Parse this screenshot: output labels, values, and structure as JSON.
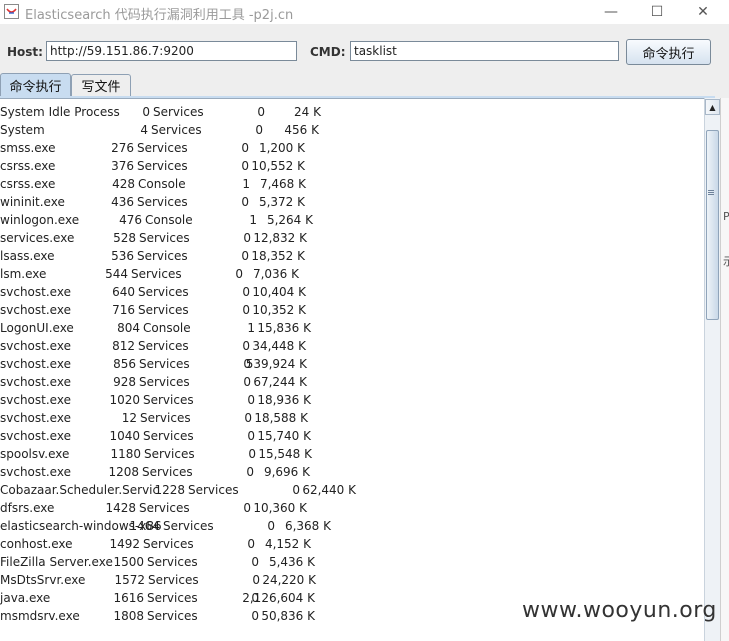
{
  "window": {
    "title": "Elasticsearch 代码执行漏洞利用工具 -p2j.cn",
    "minimize_glyph": "—",
    "maximize_glyph": "☐",
    "close_glyph": "✕"
  },
  "toolbar": {
    "host_label": "Host:",
    "host_value": "http://59.151.86.7:9200",
    "cmd_label": "CMD:",
    "cmd_value": "tasklist",
    "exec_button": "命令执行"
  },
  "tabs": [
    {
      "label": "命令执行",
      "active": true
    },
    {
      "label": "写文件",
      "active": false
    }
  ],
  "processes": [
    {
      "name": "System Idle Process",
      "pid": "0",
      "session": "Services",
      "num": "0",
      "mem": "24 K"
    },
    {
      "name": "System",
      "pid": "4",
      "session": "Services",
      "num": "0",
      "mem": "456 K"
    },
    {
      "name": "smss.exe",
      "pid": "276",
      "session": "Services",
      "num": "0",
      "mem": "1,200 K"
    },
    {
      "name": "csrss.exe",
      "pid": "376",
      "session": "Services",
      "num": "0",
      "mem": "10,552 K"
    },
    {
      "name": "csrss.exe",
      "pid": "428",
      "session": "Console",
      "num": "1",
      "mem": "7,468 K"
    },
    {
      "name": "wininit.exe",
      "pid": "436",
      "session": "Services",
      "num": "0",
      "mem": "5,372 K"
    },
    {
      "name": "winlogon.exe",
      "pid": "476",
      "session": "Console",
      "num": "1",
      "mem": "5,264 K"
    },
    {
      "name": "services.exe",
      "pid": "528",
      "session": "Services",
      "num": "0",
      "mem": "12,832 K"
    },
    {
      "name": "lsass.exe",
      "pid": "536",
      "session": "Services",
      "num": "0",
      "mem": "18,352 K"
    },
    {
      "name": "lsm.exe",
      "pid": "544",
      "session": "Services",
      "num": "0",
      "mem": "7,036 K"
    },
    {
      "name": "svchost.exe",
      "pid": "640",
      "session": "Services",
      "num": "0",
      "mem": "10,404 K"
    },
    {
      "name": "svchost.exe",
      "pid": "716",
      "session": "Services",
      "num": "0",
      "mem": "10,352 K"
    },
    {
      "name": "LogonUI.exe",
      "pid": "804",
      "session": "Console",
      "num": "1",
      "mem": "15,836 K"
    },
    {
      "name": "svchost.exe",
      "pid": "812",
      "session": "Services",
      "num": "0",
      "mem": "34,448 K"
    },
    {
      "name": "svchost.exe",
      "pid": "856",
      "session": "Services",
      "num": "0",
      "mem": "539,924 K"
    },
    {
      "name": "svchost.exe",
      "pid": "928",
      "session": "Services",
      "num": "0",
      "mem": "67,244 K"
    },
    {
      "name": "svchost.exe",
      "pid": "1020",
      "session": "Services",
      "num": "0",
      "mem": "18,936 K"
    },
    {
      "name": "svchost.exe",
      "pid": "12",
      "session": "Services",
      "num": "0",
      "mem": "18,588 K"
    },
    {
      "name": "svchost.exe",
      "pid": "1040",
      "session": "Services",
      "num": "0",
      "mem": "15,740 K"
    },
    {
      "name": "spoolsv.exe",
      "pid": "1180",
      "session": "Services",
      "num": "0",
      "mem": "15,548 K"
    },
    {
      "name": "svchost.exe",
      "pid": "1208",
      "session": "Services",
      "num": "0",
      "mem": "9,696 K"
    },
    {
      "name": "Cobazaar.Scheduler.Servic",
      "pid": "1228",
      "session": "Services",
      "num": "0",
      "mem": "62,440 K"
    },
    {
      "name": "dfsrs.exe",
      "pid": "1428",
      "session": "Services",
      "num": "0",
      "mem": "10,360 K"
    },
    {
      "name": "elasticsearch-windows-x86",
      "pid": "1464",
      "session": "Services",
      "num": "0",
      "mem": "6,368 K"
    },
    {
      "name": "conhost.exe",
      "pid": "1492",
      "session": "Services",
      "num": "0",
      "mem": "4,152 K"
    },
    {
      "name": "FileZilla Server.exe",
      "pid": "1500",
      "session": "Services",
      "num": "0",
      "mem": "5,436 K"
    },
    {
      "name": "MsDtsSrvr.exe",
      "pid": "1572",
      "session": "Services",
      "num": "0",
      "mem": "24,220 K"
    },
    {
      "name": "java.exe",
      "pid": "1616",
      "session": "Services",
      "num": "0",
      "mem": "2,126,604 K"
    },
    {
      "name": "msmdsrv.exe",
      "pid": "1808",
      "session": "Services",
      "num": "0",
      "mem": "50,836 K"
    }
  ],
  "side_strip": [
    "P",
    "示"
  ],
  "watermark": "www.wooyun.org",
  "colors": {
    "tab_active": "#c8dcf0",
    "button_border": "#7a8a99"
  }
}
